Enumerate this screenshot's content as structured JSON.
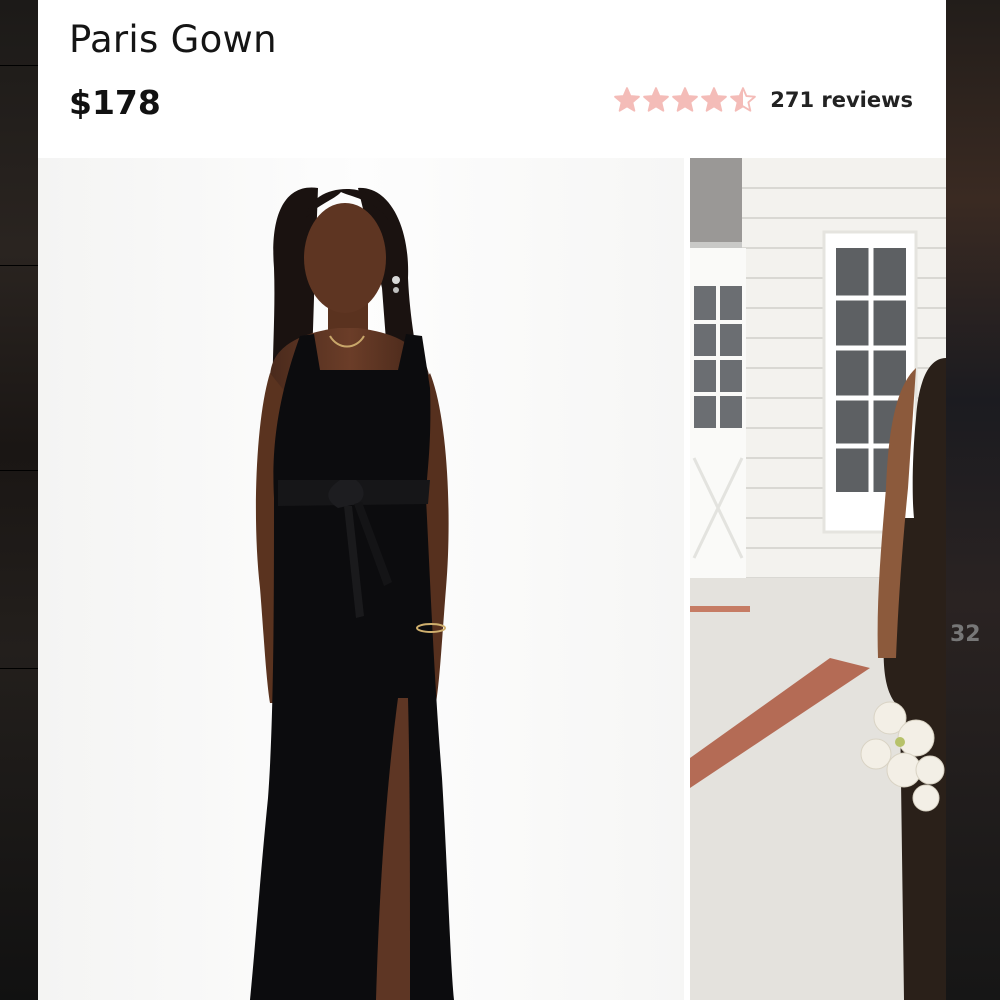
{
  "product": {
    "title": "Paris Gown",
    "price": "$178",
    "rating": 4.5,
    "rating_max": 5,
    "reviews_label": "271 reviews",
    "star_color": "#f4bcb8",
    "star_empty_color": "#f4d8d6"
  },
  "gallery": {
    "main_image_icon": "model-black-gown-photo",
    "side_image_icon": "model-outdoor-bouquet-photo"
  },
  "background": {
    "partial_count": "32"
  }
}
